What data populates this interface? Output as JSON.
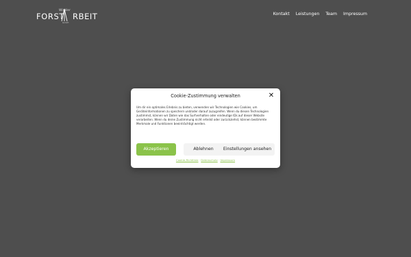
{
  "header": {
    "logo": {
      "top": "Winkler",
      "main_left": "FORST",
      "main_right": "RBEIT",
      "bottom": "GmbH"
    },
    "nav": [
      {
        "label": "Kontakt"
      },
      {
        "label": "Leistungen"
      },
      {
        "label": "Team"
      },
      {
        "label": "Impressum"
      }
    ]
  },
  "cookie_dialog": {
    "title": "Cookie-Zustimmung verwalten",
    "close_symbol": "✕",
    "text": "Um dir ein optimales Erlebnis zu bieten, verwenden wir Technologien wie Cookies, um Geräteinformationen zu speichern und/oder darauf zuzugreifen. Wenn du diesen Technologien zustimmst, können wir Daten wie das Surfverhalten oder eindeutige IDs auf dieser Website verarbeiten. Wenn du deine Zustimmung nicht erteilst oder zurückziehst, können bestimmte Merkmale und Funktionen beeinträchtigt werden.",
    "accept_label": "Akzeptieren",
    "deny_label": "Ablehnen",
    "prefs_label": "Einstellungen ansehen",
    "links": [
      {
        "label": "Cookie-Richtlinie"
      },
      {
        "label": "Datenschutz"
      },
      {
        "label": "Impressum"
      }
    ]
  },
  "colors": {
    "background": "#4e4e4e",
    "accent": "#8bc34a"
  }
}
